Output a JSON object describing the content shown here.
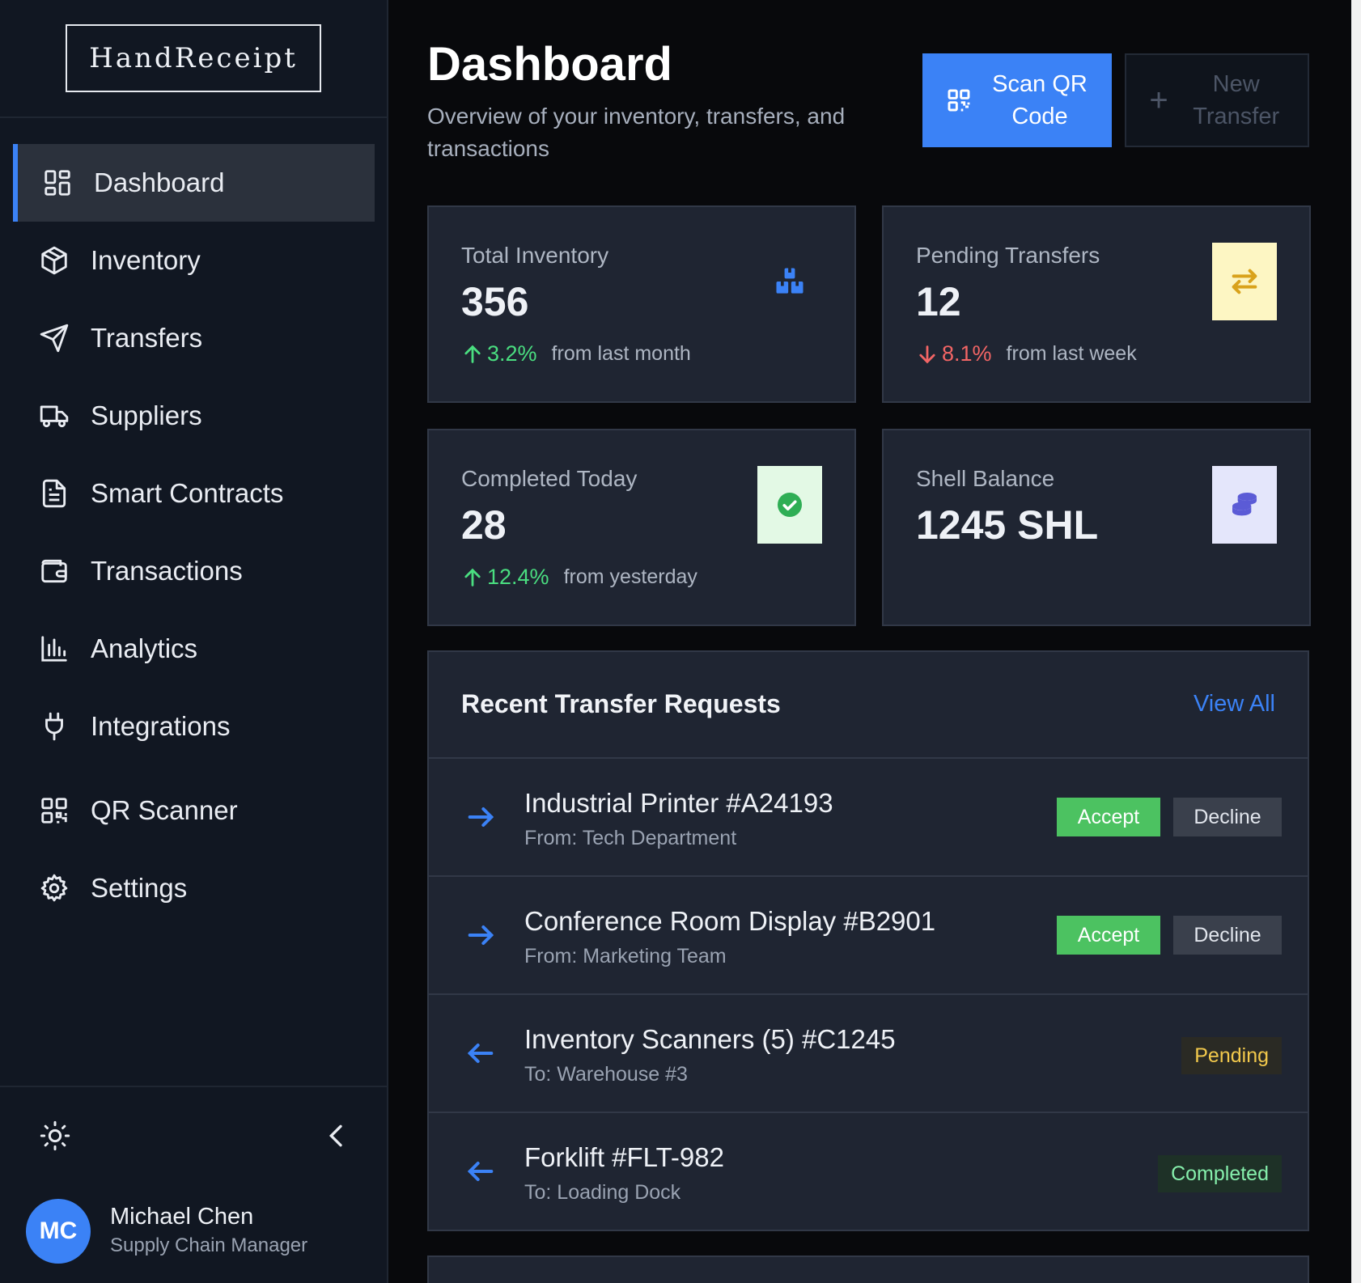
{
  "app": {
    "logo": "HandReceipt"
  },
  "sidebar": {
    "items": [
      {
        "label": "Dashboard",
        "icon": "dashboard-icon"
      },
      {
        "label": "Inventory",
        "icon": "box-icon"
      },
      {
        "label": "Transfers",
        "icon": "send-icon"
      },
      {
        "label": "Suppliers",
        "icon": "truck-icon"
      },
      {
        "label": "Smart Contracts",
        "icon": "document-icon"
      },
      {
        "label": "Transactions",
        "icon": "wallet-icon"
      },
      {
        "label": "Analytics",
        "icon": "bar-chart-icon"
      },
      {
        "label": "Integrations",
        "icon": "plug-icon"
      },
      {
        "label": "QR Scanner",
        "icon": "qr-code-icon"
      },
      {
        "label": "Settings",
        "icon": "gear-icon"
      }
    ],
    "user": {
      "initials": "MC",
      "name": "Michael Chen",
      "role": "Supply Chain Manager"
    }
  },
  "header": {
    "title": "Dashboard",
    "subtitle": "Overview of your inventory, transfers, and transactions",
    "scan_label": "Scan QR Code",
    "new_transfer_label": "New Transfer"
  },
  "stats": [
    {
      "label": "Total Inventory",
      "value": "356",
      "trend": "up",
      "pct": "3.2%",
      "note": "from last month",
      "icon": "boxes-icon"
    },
    {
      "label": "Pending Transfers",
      "value": "12",
      "trend": "down",
      "pct": "8.1%",
      "note": "from last week",
      "icon": "swap-icon",
      "badge_color": "#fdf6c3"
    },
    {
      "label": "Completed Today",
      "value": "28",
      "trend": "up",
      "pct": "12.4%",
      "note": "from yesterday",
      "icon": "check-circle-icon",
      "badge_color": "#e3f9e5"
    },
    {
      "label": "Shell Balance",
      "value": "1245 SHL",
      "icon": "coins-icon",
      "badge_color": "#e4e6fb"
    }
  ],
  "transfers": {
    "title": "Recent Transfer Requests",
    "view_all": "View All",
    "accept_label": "Accept",
    "decline_label": "Decline",
    "rows": [
      {
        "direction": "incoming",
        "title": "Industrial Printer #A24193",
        "sub": "From: Tech Department"
      },
      {
        "direction": "incoming",
        "title": "Conference Room Display #B2901",
        "sub": "From: Marketing Team"
      },
      {
        "direction": "outgoing",
        "title": "Inventory Scanners (5) #C1245",
        "sub": "To: Warehouse #3",
        "status": "Pending"
      },
      {
        "direction": "outgoing",
        "title": "Forklift #FLT-982",
        "sub": "To: Loading Dock",
        "status": "Completed"
      }
    ]
  },
  "colors": {
    "accent": "#3b82f6",
    "success": "#4cc261",
    "danger": "#f26565",
    "warning": "#f2c94c"
  }
}
